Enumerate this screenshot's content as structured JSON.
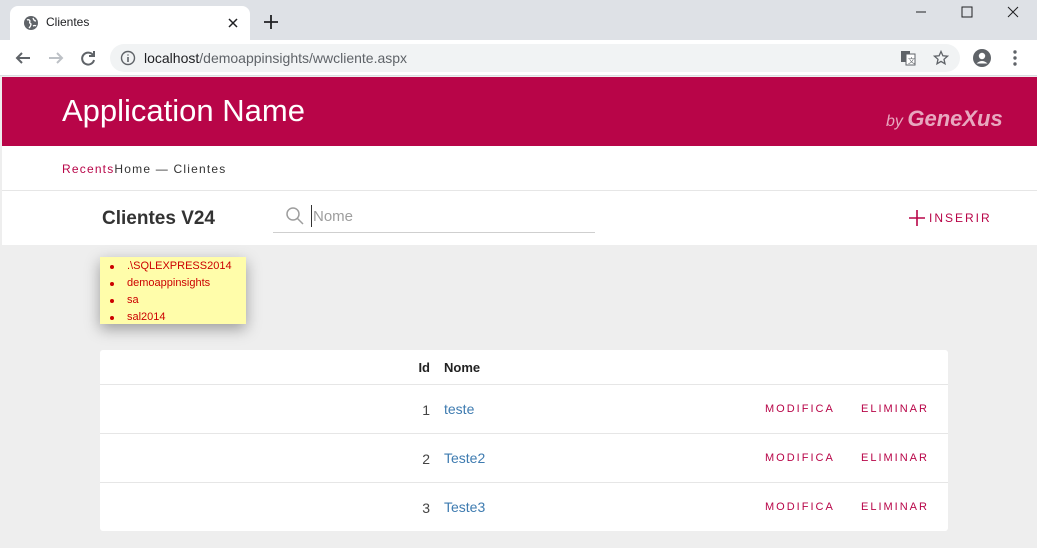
{
  "browser": {
    "tab_title": "Clientes",
    "url_host": "localhost",
    "url_path": "/demoappinsights/wwcliente.aspx"
  },
  "header": {
    "app_name": "Application Name",
    "logo_by": "by",
    "logo_brand": "GeneXus",
    "color": "#b80548"
  },
  "breadcrumb": {
    "recents": "Recents",
    "trail": "Home — Clientes"
  },
  "toolbar": {
    "title": "Clientes V24",
    "search_placeholder": "Nome",
    "insert_label": "INSERIR"
  },
  "db_info": {
    "items": [
      ".\\SQLEXPRESS2014",
      "demoappinsights",
      "sa",
      "sal2014"
    ]
  },
  "grid": {
    "headers": {
      "id": "Id",
      "nome": "Nome"
    },
    "rows": [
      {
        "id": "1",
        "nome": "teste",
        "modify": "MODIFICA",
        "delete": "ELIMINAR"
      },
      {
        "id": "2",
        "nome": "Teste2",
        "modify": "MODIFICA",
        "delete": "ELIMINAR"
      },
      {
        "id": "3",
        "nome": "Teste3",
        "modify": "MODIFICA",
        "delete": "ELIMINAR"
      }
    ]
  }
}
